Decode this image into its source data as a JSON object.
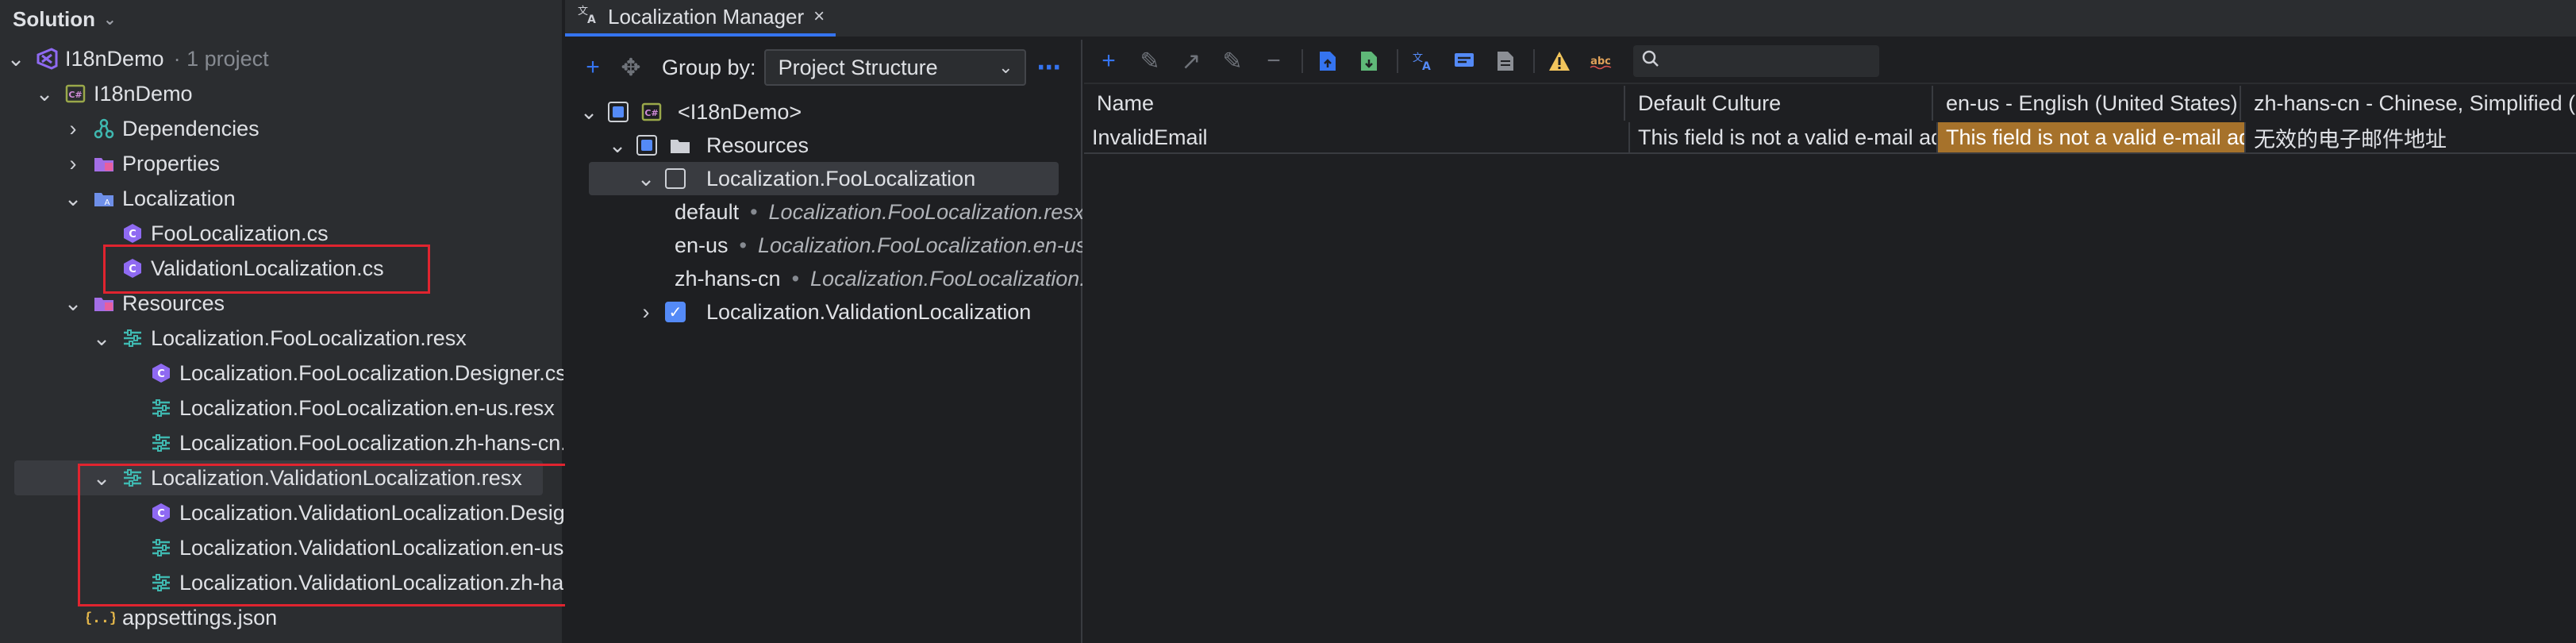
{
  "solution": {
    "header": "Solution",
    "items": [
      {
        "label": "I18nDemo",
        "suffix": "· 1 project"
      },
      {
        "label": "I18nDemo"
      },
      {
        "label": "Dependencies"
      },
      {
        "label": "Properties"
      },
      {
        "label": "Localization"
      },
      {
        "label": "FooLocalization.cs"
      },
      {
        "label": "ValidationLocalization.cs"
      },
      {
        "label": "Resources"
      },
      {
        "label": "Localization.FooLocalization.resx"
      },
      {
        "label": "Localization.FooLocalization.Designer.cs"
      },
      {
        "label": "Localization.FooLocalization.en-us.resx"
      },
      {
        "label": "Localization.FooLocalization.zh-hans-cn.resx"
      },
      {
        "label": "Localization.ValidationLocalization.resx"
      },
      {
        "label": "Localization.ValidationLocalization.Designer.cs"
      },
      {
        "label": "Localization.ValidationLocalization.en-us.resx"
      },
      {
        "label": "Localization.ValidationLocalization.zh-hans-cn.resx"
      },
      {
        "label": "appsettings.json"
      }
    ]
  },
  "manager": {
    "tab_label": "Localization Manager",
    "group_by_label": "Group by:",
    "group_by_value": "Project Structure",
    "tree": [
      {
        "label": "<I18nDemo>"
      },
      {
        "label": "Resources"
      },
      {
        "label": "Localization.FooLocalization"
      },
      {
        "culture": "default",
        "detail": "Localization.FooLocalization.resx"
      },
      {
        "culture": "en-us",
        "detail": "Localization.FooLocalization.en-us.resx"
      },
      {
        "culture": "zh-hans-cn",
        "detail": "Localization.FooLocalization.zh-hans-cn.resx"
      },
      {
        "label": "Localization.ValidationLocalization"
      }
    ],
    "grid": {
      "columns": [
        "Name",
        "Default Culture",
        "en-us - English (United States)",
        "zh-hans-cn - Chinese, Simplified (China)"
      ],
      "rows": [
        [
          "InvalidEmail",
          "This field is not a valid e-mail address.",
          "This field is not a valid e-mail address.",
          "无效的电子邮件地址"
        ]
      ]
    }
  }
}
